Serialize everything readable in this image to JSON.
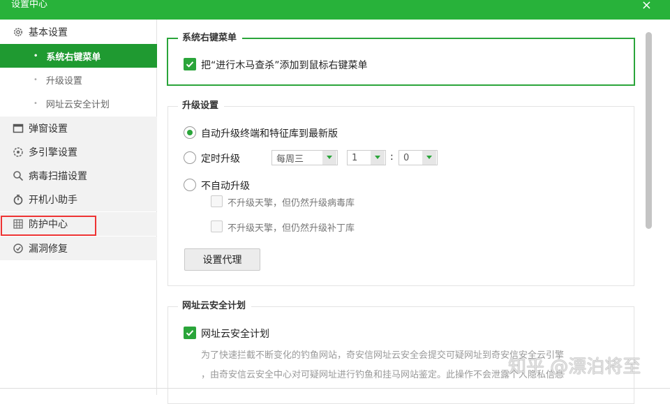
{
  "window": {
    "title": "设置中心",
    "close_glyph": "×",
    "accent": "#28b23a"
  },
  "sidebar": {
    "items": [
      {
        "label": "基本设置",
        "icon": "gear-icon"
      },
      {
        "label": "弹窗设置",
        "icon": "window-icon"
      },
      {
        "label": "多引擎设置",
        "icon": "engine-icon"
      },
      {
        "label": "病毒扫描设置",
        "icon": "search-icon"
      },
      {
        "label": "开机小助手",
        "icon": "timer-icon"
      },
      {
        "label": "防护中心",
        "icon": "shield-grid-icon"
      },
      {
        "label": "漏洞修复",
        "icon": "patch-icon"
      }
    ],
    "sub_items": [
      {
        "label": "系统右键菜单",
        "active": true
      },
      {
        "label": "升级设置",
        "active": false
      },
      {
        "label": "网址云安全计划",
        "active": false
      }
    ]
  },
  "context_menu": {
    "title": "系统右键菜单",
    "checkbox_label": "把“进行木马查杀”添加到鼠标右键菜单",
    "checked": true
  },
  "upgrade": {
    "title": "升级设置",
    "auto_label": "自动升级终端和特征库到最新版",
    "scheduled_label": "定时升级",
    "day_value": "每周三",
    "hour_value": "1",
    "colon": ":",
    "minute_value": "0",
    "manual_label": "不自动升级",
    "option1": "不升级天擎，但仍然升级病毒库",
    "option2": "不升级天擎，但仍然升级补丁库",
    "proxy_button": "设置代理",
    "selected": "auto"
  },
  "cloud": {
    "title": "网址云安全计划",
    "checkbox_label": "网址云安全计划",
    "checked": true,
    "desc1": "为了快速拦截不断变化的钓鱼网站，奇安信网址云安全会提交可疑网址到奇安信安全云引擎",
    "desc2": "，由奇安信云安全中心对可疑网址进行钓鱼和挂马网站鉴定。此操作不会泄露个人隐私信息"
  },
  "watermark": "知乎 @漂泊将至"
}
